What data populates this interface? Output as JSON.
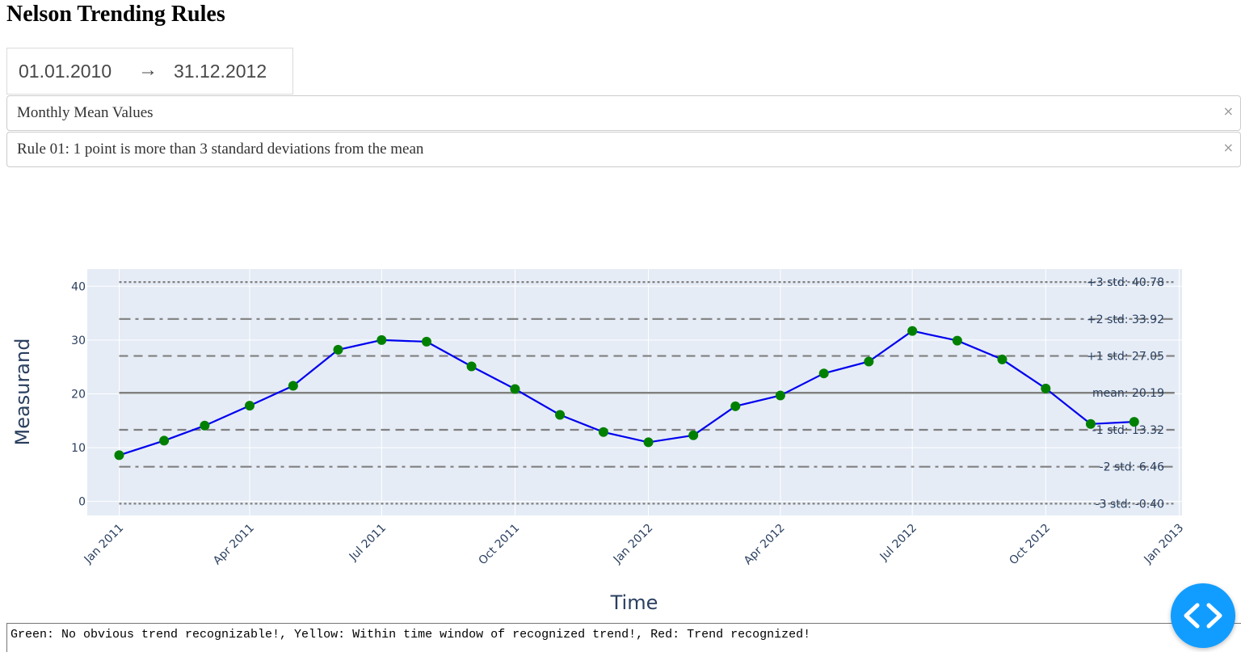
{
  "page": {
    "title": "Nelson Trending Rules"
  },
  "date_range": {
    "start": "01.01.2010",
    "arrow": "→",
    "end": "31.12.2012"
  },
  "measure_dropdown": {
    "value": "Monthly Mean Values",
    "clear": "×"
  },
  "rule_dropdown": {
    "value": "Rule 01: 1 point is more than 3 standard deviations from the mean",
    "clear": "×"
  },
  "footer": {
    "legend": "Green: No obvious trend recognizable!, Yellow: Within time window of recognized trend!, Red: Trend recognized!"
  },
  "colors": {
    "line": "#0000ee",
    "marker": "#008000",
    "reference": "#808080",
    "plot_bg": "#e5ecf6",
    "debug_button": "#119dff"
  },
  "icons": {
    "debug": "code-brackets-icon"
  },
  "chart_data": {
    "type": "line",
    "xlabel": "Time",
    "ylabel": "Measurand",
    "x_tick_labels": [
      "Jan 2011",
      "Apr 2011",
      "Jul 2011",
      "Oct 2011",
      "Jan 2012",
      "Apr 2012",
      "Jul 2012",
      "Oct 2012",
      "Jan 2013"
    ],
    "y_ticks": [
      0,
      10,
      20,
      30,
      40
    ],
    "xlim": [
      "2010-12-10",
      "2013-01-03"
    ],
    "ylim": [
      -2.6,
      43.2
    ],
    "grid": true,
    "series": [
      {
        "x": [
          "2011-01-01",
          "2011-02-01",
          "2011-03-01",
          "2011-04-01",
          "2011-05-01",
          "2011-06-01",
          "2011-07-01",
          "2011-08-01",
          "2011-09-01",
          "2011-10-01",
          "2011-11-01",
          "2011-12-01",
          "2012-01-01",
          "2012-02-01",
          "2012-03-01",
          "2012-04-01",
          "2012-05-01",
          "2012-06-01",
          "2012-07-01",
          "2012-08-01",
          "2012-09-01",
          "2012-10-01",
          "2012-11-01",
          "2012-12-01"
        ],
        "y": [
          8.6,
          11.3,
          14.1,
          17.8,
          21.5,
          28.2,
          30.0,
          29.7,
          25.1,
          20.9,
          16.1,
          12.9,
          11.0,
          12.3,
          17.7,
          19.7,
          23.8,
          26.0,
          31.7,
          29.9,
          26.4,
          21.0,
          14.4,
          14.8
        ]
      }
    ],
    "reference_lines": [
      {
        "label": "+3 std: 40.78",
        "value": 40.78,
        "style": "dotted"
      },
      {
        "label": "+2 std: 33.92",
        "value": 33.92,
        "style": "dashdot"
      },
      {
        "label": "+1 std: 27.05",
        "value": 27.05,
        "style": "dashed"
      },
      {
        "label": "mean: 20.19",
        "value": 20.19,
        "style": "solid"
      },
      {
        "label": "-1 std: 13.32",
        "value": 13.32,
        "style": "dashed"
      },
      {
        "label": "-2 std: 6.46",
        "value": 6.46,
        "style": "dashdot"
      },
      {
        "label": "-3 std: -0.40",
        "value": -0.4,
        "style": "dotted"
      }
    ]
  }
}
